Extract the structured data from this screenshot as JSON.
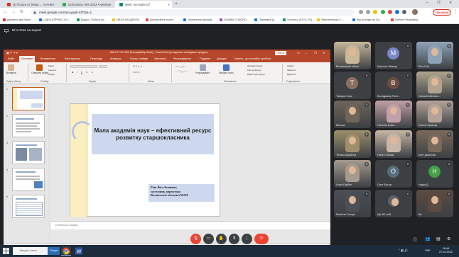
{
  "browser": {
    "tabs": [
      {
        "title": "(1) Пошта от [Нова ... 4 учнів",
        "active": false
      },
      {
        "title": "Schoolnavi: Win 2022 • натиску",
        "active": false
      },
      {
        "title": "Meet: ryo-yyqh-nzf",
        "active": true
      }
    ],
    "url": "meet.google.com/ryo-yyqh-nzf?pli=1",
    "update_label": "Обновить",
    "bookmarks": [
      "Дрифтер для Брон...",
      "Ч.ДНь ЕЗРНИС ЮЗ...",
      "Відділ • Побутр-пу...",
      "МАЛА АКАДЕМІЯ...",
      "Дистанційне рішен...",
      "Управління Держав...",
      "ОЦІНКА ОЧИСНО...",
      "Перевірка Д...",
      "Учители_WJCE_РЦ...",
      "Звернення до 5-...",
      "Від сьогодні на Бо...",
      "Human Geography..."
    ]
  },
  "meet": {
    "presenter_banner": "Віта Роїк на екрані",
    "meeting_code": "18:44  |  ryo-yyqh-nzf",
    "participants": [
      {
        "name": "Волинський облас...",
        "type": "photo",
        "color": "#c9b89a"
      },
      {
        "name": "Мар'яна Шевчук",
        "type": "initial",
        "initial": "М",
        "color": "#7986cb"
      },
      {
        "name": "Віта Роїк",
        "type": "photo",
        "color": "#8fa3b8"
      },
      {
        "name": "Тамара Ноєк",
        "type": "initial",
        "initial": "Т",
        "color": "#8d6e63"
      },
      {
        "name": "Володимир Полі...",
        "type": "initial",
        "initial": "В",
        "color": "#6d4c41"
      },
      {
        "name": "Оксана Мисюсь...",
        "type": "photo",
        "color": "#b0a48e"
      },
      {
        "name": "Мілена",
        "type": "photo",
        "color": "#6f6659"
      },
      {
        "name": "Наталія Блаж...",
        "type": "photo",
        "color": "#c2a0a8"
      },
      {
        "name": "Олена Кравчук",
        "type": "photo",
        "color": "#b5a399"
      },
      {
        "name": "Тетяна Дарійчук",
        "type": "photo",
        "color": "#9e8f6c"
      },
      {
        "name": "Настя Пешик",
        "type": "photo",
        "color": "#c8b7a6"
      },
      {
        "name": "олег дмитров",
        "type": "photo",
        "color": "#7a6a5b"
      },
      {
        "name": "Алла Гарбат",
        "type": "photo",
        "color": "#a59a8c"
      },
      {
        "name": "Олег Багаж",
        "type": "initial",
        "initial": "О",
        "color": "#546e7a"
      },
      {
        "name": "Надія Д.",
        "type": "initial",
        "initial": "Н",
        "color": "#43a047"
      },
      {
        "name": "Mariana Orusyk",
        "type": "photo",
        "color": "#4b4f56"
      },
      {
        "name": "Ще 80 осіб",
        "type": "more",
        "color": "#3c4043"
      },
      {
        "name": "Ви",
        "type": "photo",
        "color": "#5d4a42"
      }
    ]
  },
  "ppt": {
    "window_title": "МАН 27.10.2022 [Compatibility Mode] - PowerPoint (не вдалося активувати продукт)",
    "signin": "Увійти",
    "tabs": [
      "Файл",
      "Основне",
      "Вставлення",
      "Конструктор",
      "Переходи",
      "Анімація",
      "Показ слайдів",
      "Записати",
      "Рецензування",
      "Подання",
      "Довідка",
      "Скажіть, що потрібно зробити"
    ],
    "ribbon": {
      "clipboard": "Буфер обміну",
      "slides": "Слайди",
      "font": "Шрифт",
      "paragraph": "Абзац",
      "drawing": "Малювання",
      "editing": "Редагування",
      "paste": "Вставити",
      "new_slide": "Створити слайд",
      "layout": "Макет",
      "reset": "Скинути",
      "section": "Розділ",
      "arrange": "Упорядкувати",
      "quick_styles": "Експрес-стилі",
      "shape_fill": "Заливка фігури",
      "shape_outline": "Контур фігури",
      "shape_effects": "Ефекти для фігур",
      "find": "Знайти",
      "replace": "Замінити",
      "select": "Виділити"
    },
    "thumbnails": [
      "1",
      "2",
      "3",
      "4",
      "5"
    ],
    "slide": {
      "title": "Мала академія наук – ефективний ресурс розвитку старшокласника",
      "sub_lines": [
        "Роїк Віта Іванівна,",
        "заступник директора",
        "Волинської обласної МАН"
      ]
    },
    "notes_placeholder": "Нотатки до слайда",
    "status": {
      "slide_count": "Слайд 1 з 33",
      "accessibility": "Спеціальні можливості: недоступно",
      "notes": "Нотатки",
      "comments": "Примітки",
      "zoom": "66%"
    }
  },
  "taskbar": {
    "search_placeholder": "Введіть запит",
    "search_button": "Пошук",
    "time": "18:44",
    "date": "27.10.2022",
    "lang": "УКР"
  }
}
